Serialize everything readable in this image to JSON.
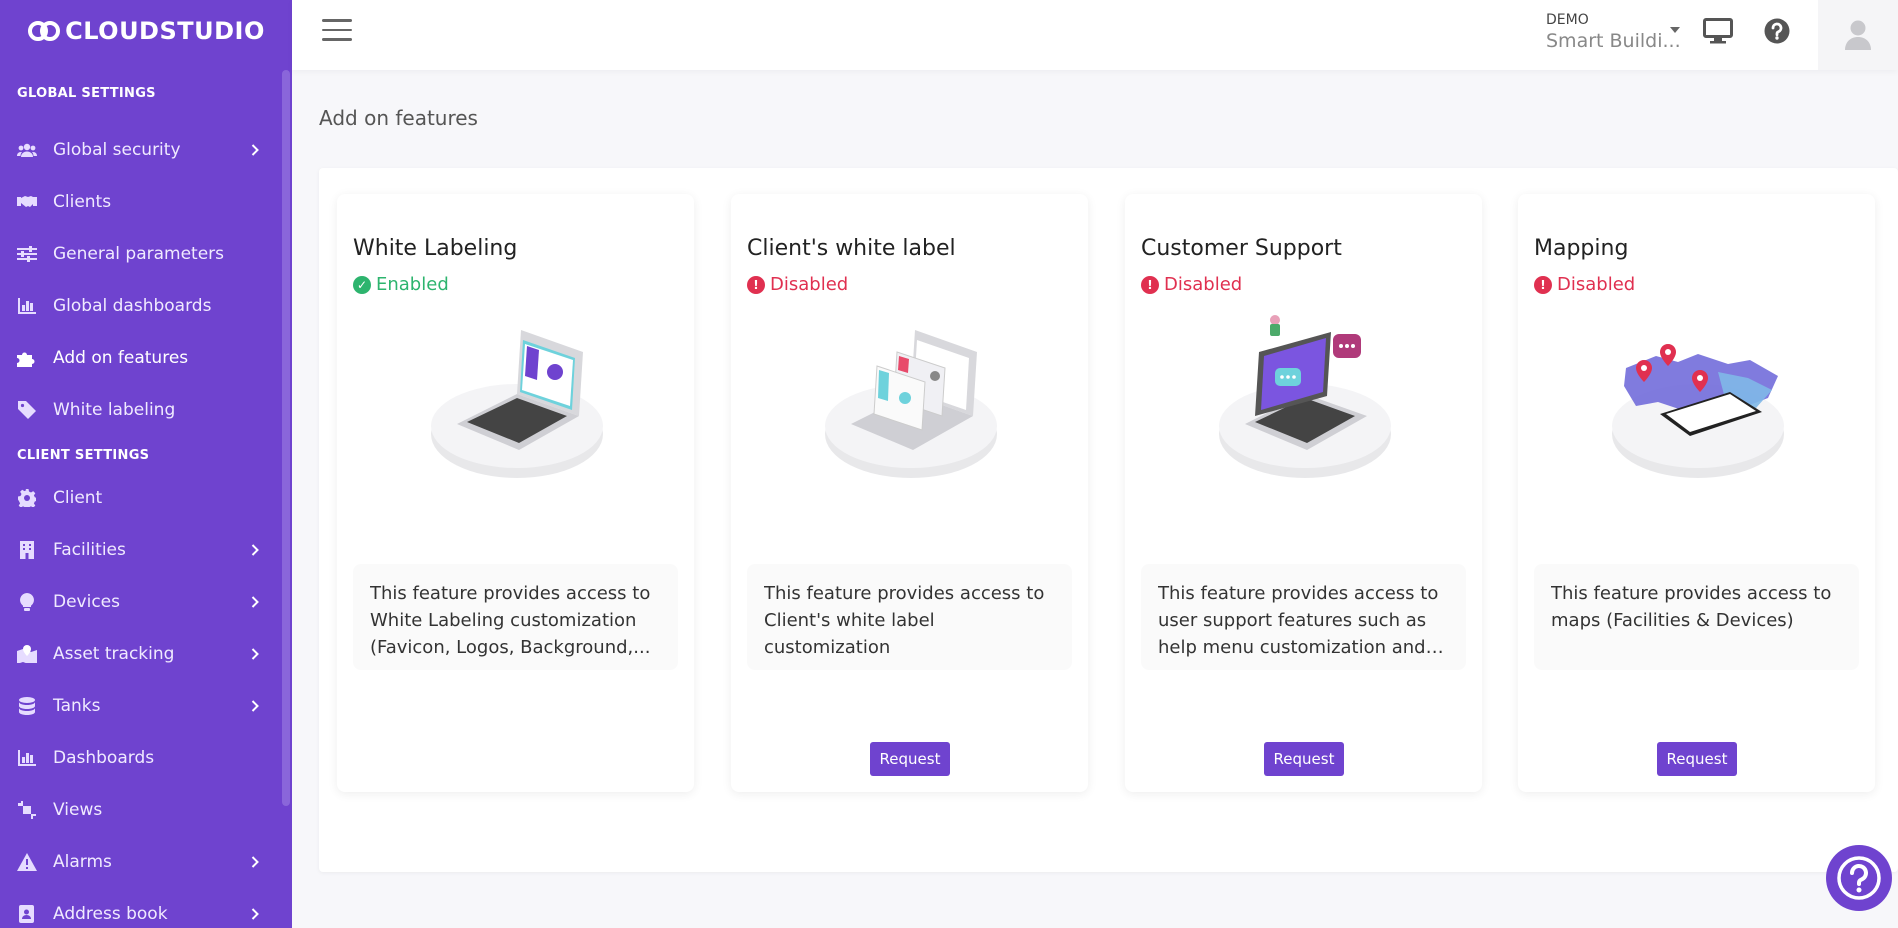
{
  "brand": {
    "name": "CLOUDSTUDIO",
    "accent": "#6f43cf"
  },
  "sidebar": {
    "sections": [
      {
        "title": "GLOBAL SETTINGS",
        "items": [
          {
            "label": "Global security",
            "icon": "users-icon",
            "has_submenu": true
          },
          {
            "label": "Clients",
            "icon": "handshake-icon",
            "has_submenu": false
          },
          {
            "label": "General parameters",
            "icon": "sliders-icon",
            "has_submenu": false
          },
          {
            "label": "Global dashboards",
            "icon": "bar-chart-icon",
            "has_submenu": false
          },
          {
            "label": "Add on features",
            "icon": "puzzle-icon",
            "has_submenu": false,
            "active": true
          },
          {
            "label": "White labeling",
            "icon": "tag-icon",
            "has_submenu": false
          }
        ]
      },
      {
        "title": "CLIENT SETTINGS",
        "items": [
          {
            "label": "Client",
            "icon": "gear-icon",
            "has_submenu": false
          },
          {
            "label": "Facilities",
            "icon": "building-icon",
            "has_submenu": true
          },
          {
            "label": "Devices",
            "icon": "lightbulb-icon",
            "has_submenu": true
          },
          {
            "label": "Asset tracking",
            "icon": "map-marker-icon",
            "has_submenu": true
          },
          {
            "label": "Tanks",
            "icon": "database-icon",
            "has_submenu": true
          },
          {
            "label": "Dashboards",
            "icon": "bar-chart-icon",
            "has_submenu": false
          },
          {
            "label": "Views",
            "icon": "crop-icon",
            "has_submenu": false
          },
          {
            "label": "Alarms",
            "icon": "warning-icon",
            "has_submenu": true
          },
          {
            "label": "Address book",
            "icon": "address-book-icon",
            "has_submenu": true
          }
        ]
      }
    ]
  },
  "header": {
    "tenant_label": "DEMO",
    "tenant_name": "Smart Buildi..."
  },
  "main": {
    "page_title": "Add on features",
    "cards": [
      {
        "title": "White Labeling",
        "status": "Enabled",
        "status_type": "enabled",
        "description": "This feature provides access to White Labeling customization (Favicon, Logos, Background,...",
        "illustration": "laptop-illustration",
        "button": null
      },
      {
        "title": "Client's white label",
        "status": "Disabled",
        "status_type": "disabled",
        "description": "This feature provides access to Client's white label customization",
        "illustration": "laptop-pages-illustration",
        "button": "Request"
      },
      {
        "title": "Customer Support",
        "status": "Disabled",
        "status_type": "disabled",
        "description": "This feature provides access to user support features such as help menu customization and integration wit...",
        "illustration": "laptop-chat-illustration",
        "button": "Request"
      },
      {
        "title": "Mapping",
        "status": "Disabled",
        "status_type": "disabled",
        "description": "This feature provides access to maps (Facilities & Devices)",
        "illustration": "map-phone-illustration",
        "button": "Request"
      }
    ]
  }
}
